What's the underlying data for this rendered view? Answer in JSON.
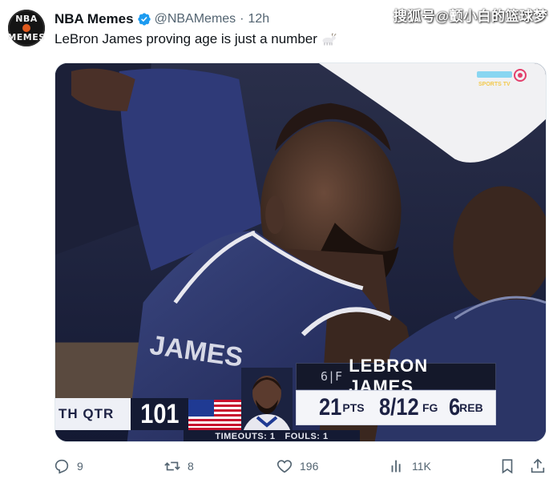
{
  "author": {
    "display_name": "NBA Memes",
    "handle": "@NBAMemes",
    "time": "12h",
    "verified": true,
    "avatar_text_top": "NBA",
    "avatar_text_bottom": "MEMES"
  },
  "watermark": "搜狐号@颤小白的篮球梦",
  "tweet": {
    "text": "LeBron James proving age is just a number",
    "emoji": "goat-icon"
  },
  "media": {
    "jersey_name": "JAMES",
    "broadcaster": "SPORTS TV",
    "scorebug": {
      "quarter": "TH QTR",
      "score": "101",
      "timeouts_label": "TIMEOUTS: 1",
      "fouls_label": "FOULS: 1",
      "player_number": "6|F",
      "player_name": "LEBRON JAMES",
      "stats": [
        {
          "value": "21",
          "label": "PTS"
        },
        {
          "value": "8/12",
          "label": "FG"
        },
        {
          "value": "6",
          "label": "REB"
        }
      ]
    }
  },
  "actions": {
    "replies": "9",
    "reposts": "8",
    "likes": "196",
    "views": "11K"
  },
  "colors": {
    "verified_blue": "#1d9bf0",
    "muted_text": "#536471",
    "jersey_navy": "#2a3566"
  }
}
